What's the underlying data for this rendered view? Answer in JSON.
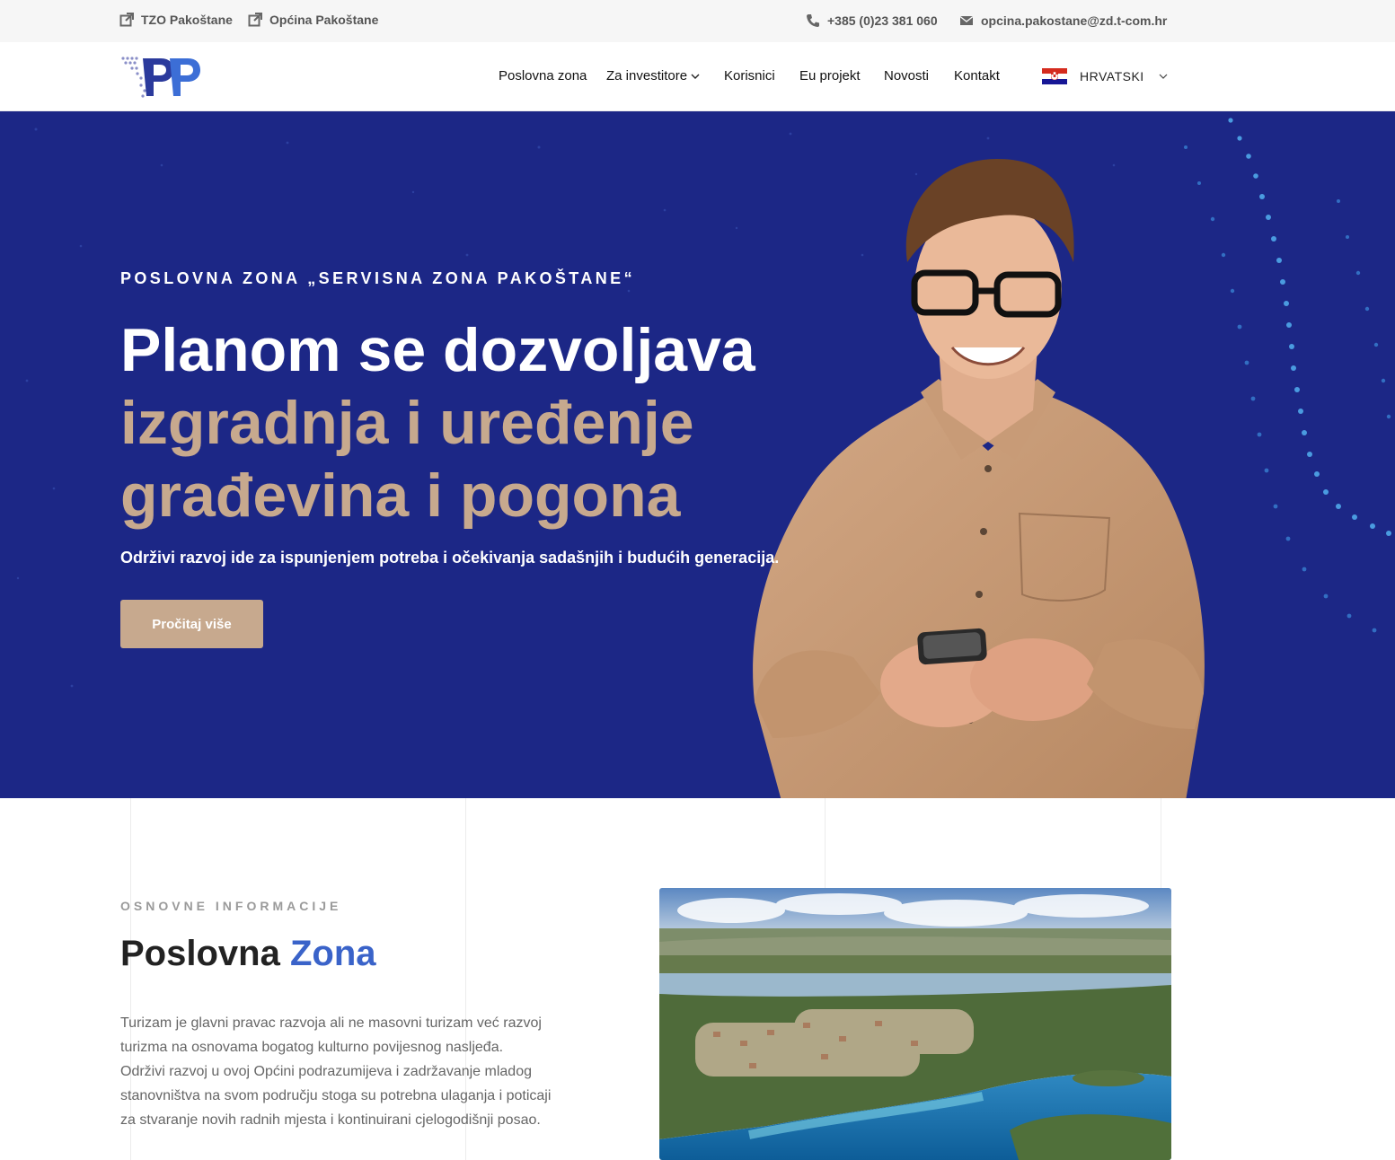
{
  "topbar": {
    "link1": "TZO Pakoštane",
    "link2": "Općina Pakoštane",
    "phone": "+385 (0)23 381 060",
    "email": "opcina.pakostane@zd.t-com.hr"
  },
  "nav": {
    "items": [
      "Poslovna zona",
      "Za investitore",
      "Korisnici",
      "Eu projekt",
      "Novosti",
      "Kontakt"
    ],
    "language": "HRVATSKI"
  },
  "hero": {
    "eyebrow": "POSLOVNA ZONA „SERVISNA ZONA PAKOŠTANE“",
    "title_line1": "Planom se dozvoljava",
    "title_line2": "izgradnja i uređenje",
    "title_line3": "građevina i pogona",
    "subtitle": "Održivi razvoj ide za ispunjenjem potreba i očekivanja sadašnjih i budućih generacija.",
    "button": "Pročitaj više"
  },
  "info": {
    "eyebrow": "OSNOVNE INFORMACIJE",
    "title_a": "Poslovna",
    "title_b": "Zona",
    "body": "Turizam je glavni pravac razvoja ali ne masovni turizam već razvoj turizma na osnovama bogatog kulturno povijesnog nasljeđa. Održivi razvoj u ovoj Općini podrazumijeva i zadržavanje mladog stanovništva na svom području stoga su potrebna ulaganja i poticaji za stvaranje novih radnih mjesta i kontinuirani cjelogodišnji posao."
  },
  "colors": {
    "hero_bg": "#1c2786",
    "accent_tan": "#c7a98e",
    "accent_blue": "#3a63c9"
  }
}
